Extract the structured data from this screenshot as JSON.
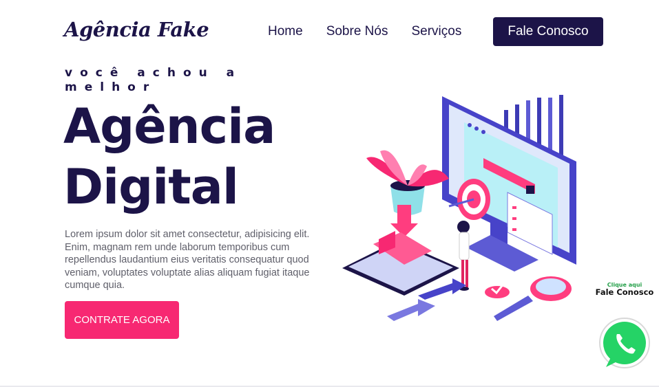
{
  "brand": {
    "logo_text": "Agência Fake"
  },
  "nav": {
    "items": [
      {
        "label": "Home"
      },
      {
        "label": "Sobre Nós"
      },
      {
        "label": "Serviços"
      }
    ],
    "cta_label": "Fale Conosco"
  },
  "hero": {
    "tagline": "você achou a melhor",
    "title_line1": "Agência",
    "title_line2": "Digital",
    "description": "Lorem ipsum dolor sit amet consectetur, adipisicing elit. Enim, magnam rem unde laborum temporibus cum repellendus laudantium eius veritatis consequatur quod veniam, voluptates voluptate alias aliquam fugiat itaque cumque quia.",
    "cta_label": "CONTRATE AGORA"
  },
  "whatsapp": {
    "small_text": "Clique aqui",
    "big_text": "Fale Conosco",
    "icon": "whatsapp-icon"
  },
  "colors": {
    "navy": "#1c1448",
    "pink": "#f72872",
    "whatsapp_green": "#25d366",
    "illustration_purple": "#5d5bd4"
  }
}
